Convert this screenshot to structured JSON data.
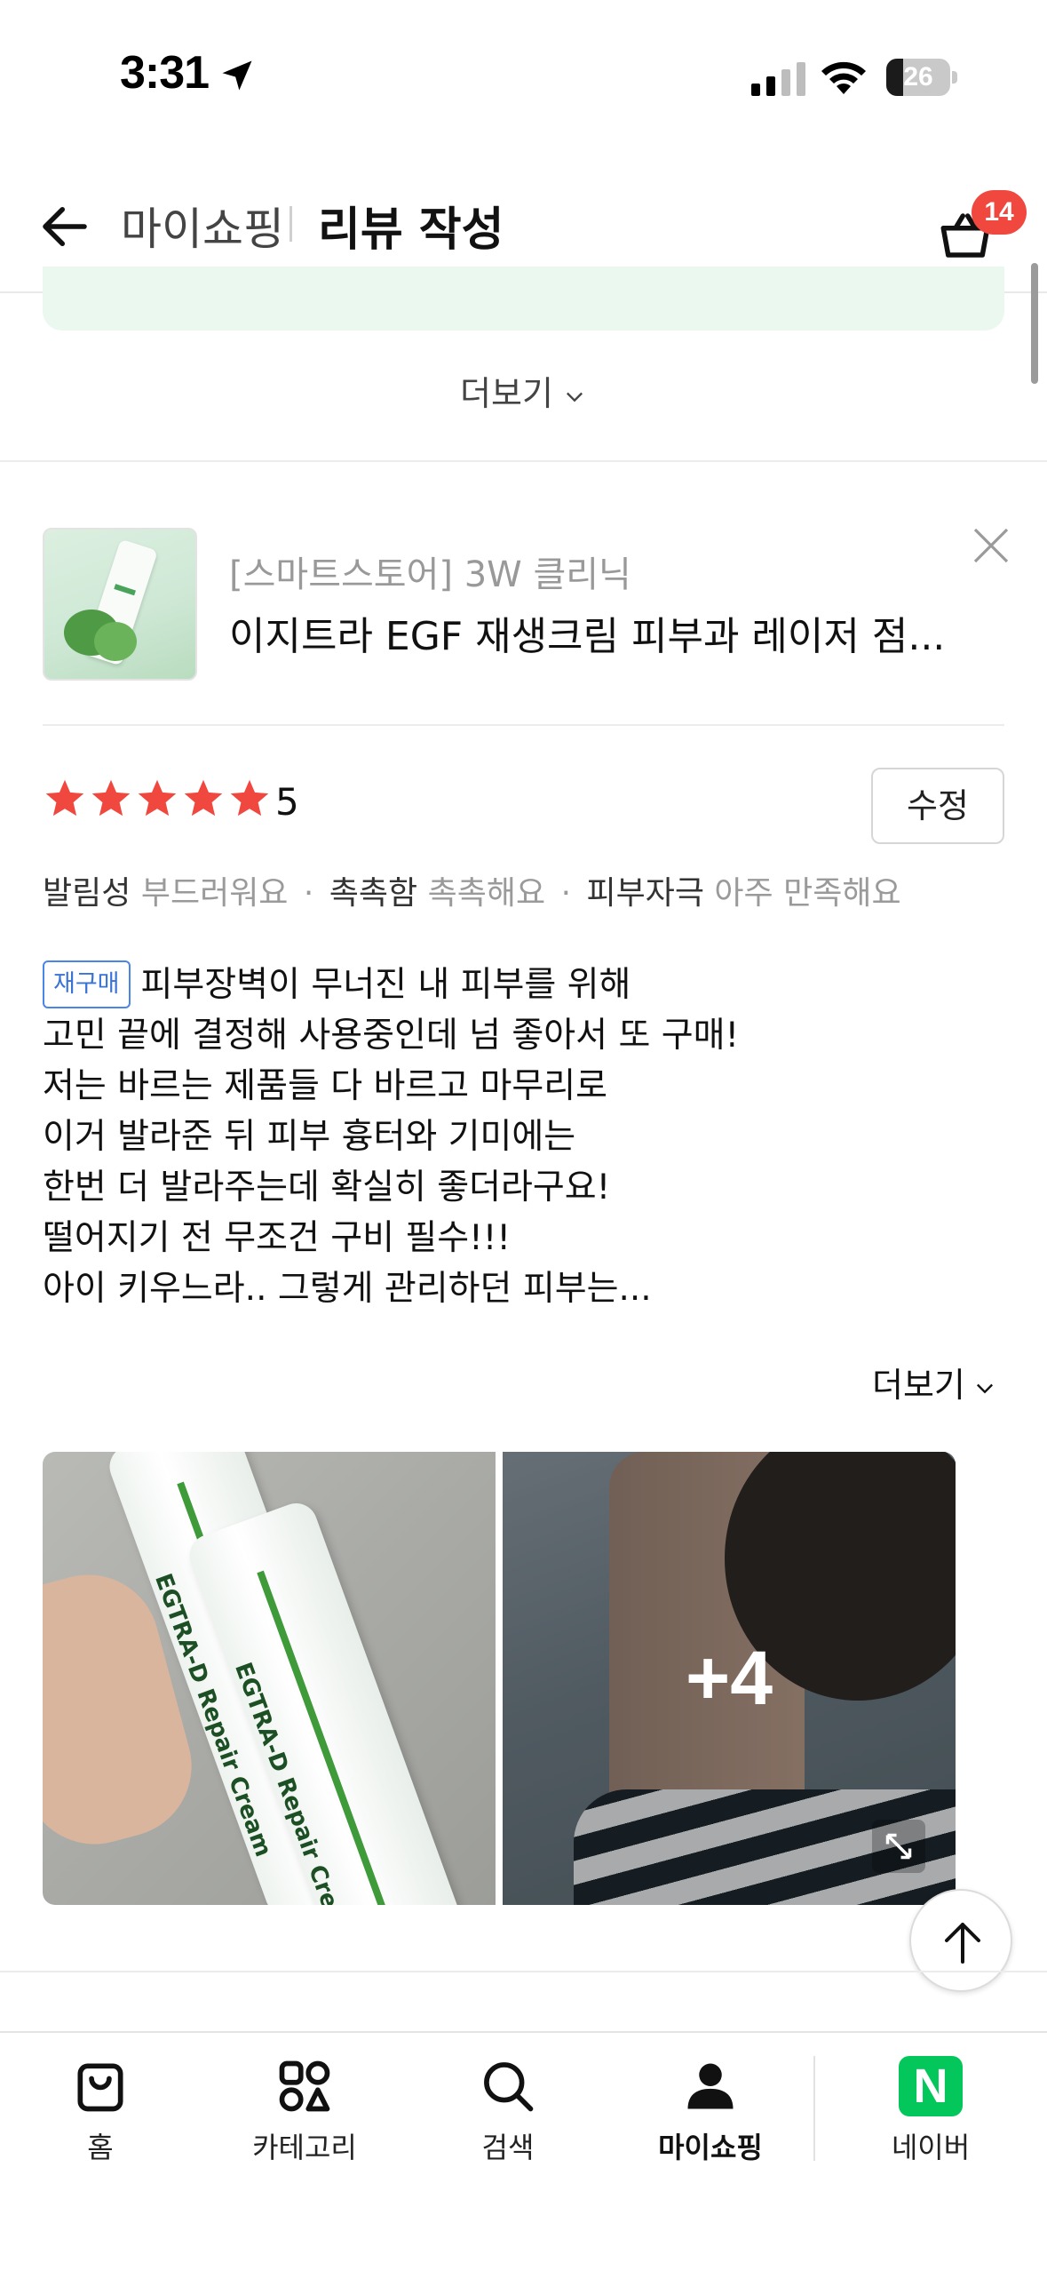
{
  "status_bar": {
    "time": "3:31",
    "battery": "26",
    "battery_level": 0.26
  },
  "header": {
    "breadcrumb_parent": "마이쇼핑",
    "title": "리뷰 작성",
    "cart_count": "14"
  },
  "top_section": {
    "more_label": "더보기"
  },
  "product": {
    "store": "[스마트스토어] 3W 클리닉",
    "name": "이지트라 EGF 재생크림 피부과 레이저 점..."
  },
  "rating": {
    "stars": 5,
    "value": "5",
    "edit_label": "수정"
  },
  "evaluations": [
    {
      "label": "발림성",
      "value": "부드러워요"
    },
    {
      "label": "촉촉함",
      "value": "촉촉해요"
    },
    {
      "label": "피부자극",
      "value": "아주 만족해요"
    }
  ],
  "review": {
    "badge": "재구매",
    "lines": [
      "피부장벽이 무너진 내 피부를 위해",
      "고민 끝에 결정해 사용중인데 넘 좋아서 또 구매!",
      "저는 바르는 제품들 다 바르고 마무리로",
      "이거 발라준 뒤 피부 흉터와 기미에는",
      "한번 더 발라주는데 확실히 좋더라구요!",
      "떨어지기 전 무조건 구비 필수!!!",
      "아이 키우느라.. 그렇게 관리하던 피부는..."
    ],
    "more_label": "더보기"
  },
  "photos": {
    "product_text": "EGTRA-D Repair Cream",
    "more_count": "+4"
  },
  "tab_bar": {
    "tabs": [
      {
        "label": "홈",
        "icon": "shopping-bag-icon"
      },
      {
        "label": "카테고리",
        "icon": "category-grid-icon"
      },
      {
        "label": "검색",
        "icon": "search-icon"
      },
      {
        "label": "마이쇼핑",
        "icon": "person-icon",
        "active": true
      },
      {
        "label": "네이버",
        "icon": "naver-logo"
      }
    ],
    "naver_letter": "N"
  },
  "colors": {
    "star": "#f0473e",
    "badge": "#f0473e",
    "repurchase": "#3a73d6",
    "naver": "#03c75a",
    "highlight_bg": "#eaf8ef"
  }
}
